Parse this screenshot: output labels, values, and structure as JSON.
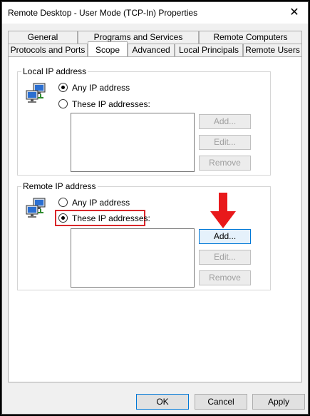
{
  "window": {
    "title": "Remote Desktop - User Mode (TCP-In) Properties",
    "close_glyph": "✕"
  },
  "tabs": {
    "row1": [
      "General",
      "Programs and Services",
      "Remote Computers"
    ],
    "row2": [
      "Protocols and Ports",
      "Scope",
      "Advanced",
      "Local Principals",
      "Remote Users"
    ],
    "active": "Scope"
  },
  "local_ip": {
    "group_label": "Local IP address",
    "any_label": "Any IP address",
    "these_label": "These IP addresses:",
    "selected": "any",
    "buttons": {
      "add": "Add...",
      "edit": "Edit...",
      "remove": "Remove"
    },
    "icon": "network-computers-icon"
  },
  "remote_ip": {
    "group_label": "Remote IP address",
    "any_label": "Any IP address",
    "these_label": "These IP addresses:",
    "selected": "these",
    "buttons": {
      "add": "Add...",
      "edit": "Edit...",
      "remove": "Remove"
    },
    "icon": "network-computers-icon"
  },
  "annotations": {
    "highlight_color": "#d9262a",
    "arrow_color": "#e8191b",
    "arrow_icon": "down-arrow-icon"
  },
  "footer": {
    "ok": "OK",
    "cancel": "Cancel",
    "apply": "Apply"
  }
}
